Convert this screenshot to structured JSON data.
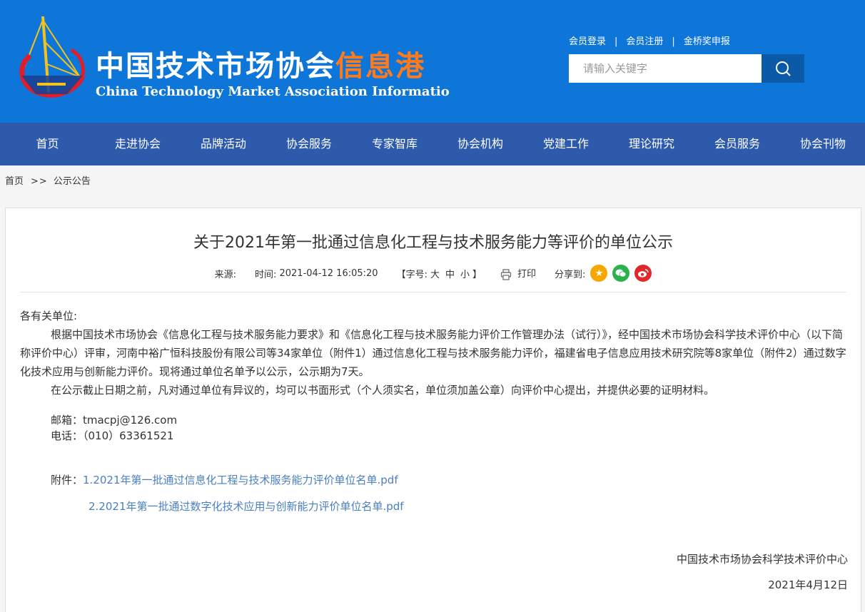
{
  "header": {
    "brand_cn_main": "中国技术市场协会",
    "brand_cn_highlight": "信息港",
    "brand_en": "China Technology Market Association Information Por",
    "top_links": [
      "会员登录",
      "会员注册",
      "金桥奖申报"
    ],
    "search_placeholder": "请输入关键字",
    "colors": {
      "header_bg": "#0e76d8",
      "highlight": "#ff7a1a",
      "nav_bg": "#2d5aaa"
    }
  },
  "nav": [
    "首页",
    "走进协会",
    "品牌活动",
    "协会服务",
    "专家智库",
    "协会机构",
    "党建工作",
    "理论研究",
    "会员服务",
    "协会刊物"
  ],
  "breadcrumb": {
    "home": "首页",
    "separator": ">>",
    "current": "公示公告"
  },
  "article": {
    "title": "关于2021年第一批通过信息化工程与技术服务能力等评价的单位公示",
    "meta": {
      "source_label": "来源:",
      "time_label": "时间:",
      "time_value": "2021-04-12 16:05:20",
      "fontsize_label": "【字号:",
      "fontsize_large": "大",
      "fontsize_medium": "中",
      "fontsize_small": "小",
      "fontsize_end": "】",
      "print_label": "打印",
      "share_label": "分享到:"
    },
    "greeting": "各有关单位:",
    "para1": "根据中国技术市场协会《信息化工程与技术服务能力要求》和《信息化工程与技术服务能力评价工作管理办法（试行）》，经中国技术市场协会科学技术评价中心（以下简称评价中心）评审，河南中裕广恒科技股份有限公司等34家单位（附件1）通过信息化工程与技术服务能力评价，福建省电子信息应用技术研究院等8家单位（附件2）通过数字化技术应用与创新能力评价。现将通过单位名单予以公示，公示期为7天。",
    "para2": "在公示截止日期之前，凡对通过单位有异议的，均可以书面形式（个人须实名，单位须加盖公章）向评价中心提出，并提供必要的证明材料。",
    "email": "邮箱：tmacpj@126.com",
    "phone": "电话：（010）63361521",
    "attach_label": "附件：",
    "attachment1": "1.2021年第一批通过信息化工程与技术服务能力评价单位名单.pdf",
    "attachment2": "2.2021年第一批通过数字化技术应用与创新能力评价单位名单.pdf",
    "signature": "中国技术市场协会科学技术评价中心",
    "date": "2021年4月12日",
    "colors": {
      "link": "#4a7fc1"
    }
  },
  "icons": {
    "search": "search-icon",
    "print": "printer-icon",
    "share": [
      "qzone-star-icon",
      "wechat-icon",
      "weibo-icon"
    ]
  }
}
